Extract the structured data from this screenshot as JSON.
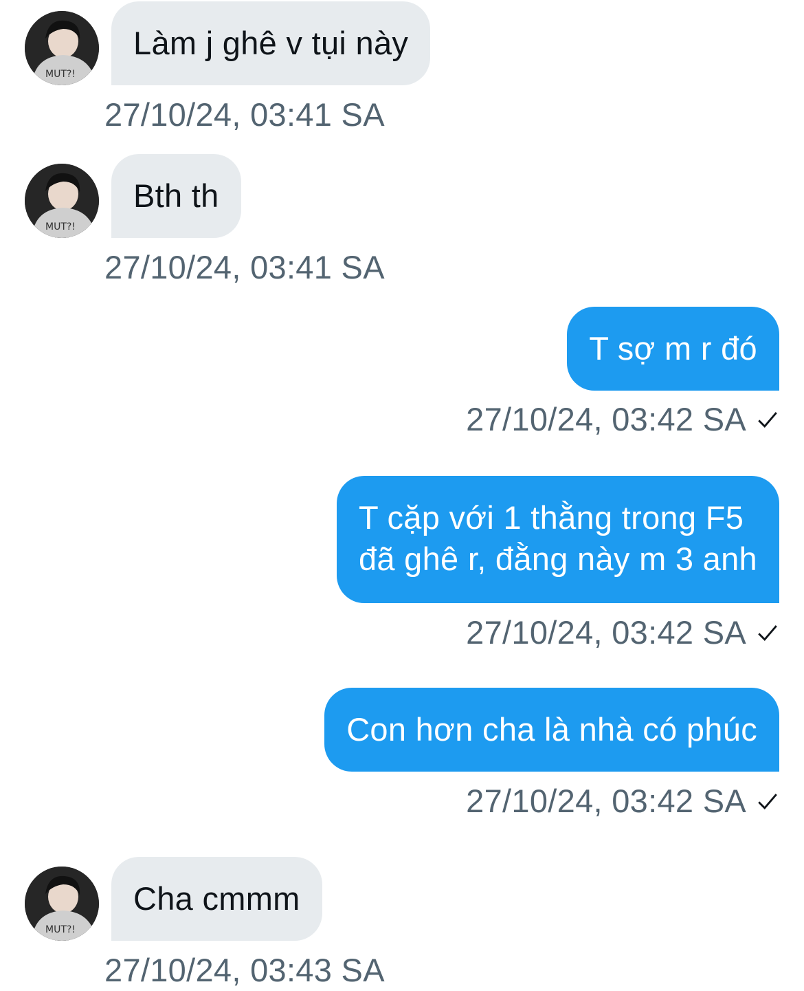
{
  "colors": {
    "incoming_bubble": "#e7ebee",
    "outgoing_bubble": "#1d9bf0",
    "timestamp": "#536471",
    "incoming_text": "#0f1419",
    "outgoing_text": "#ffffff"
  },
  "messages": [
    {
      "direction": "in",
      "text": "Làm j ghê v tụi này",
      "time": "27/10/24, 03:41 SA"
    },
    {
      "direction": "in",
      "text": "Bth th",
      "time": "27/10/24, 03:41 SA"
    },
    {
      "direction": "out",
      "text": "T sợ m r đó",
      "time": "27/10/24, 03:42 SA",
      "status_icon": "check-icon"
    },
    {
      "direction": "out",
      "text_line1": "T cặp với 1 thằng trong F5",
      "text_line2": "đã ghê r, đằng này m 3 anh",
      "time": "27/10/24, 03:42 SA",
      "status_icon": "check-icon"
    },
    {
      "direction": "out",
      "text": "Con hơn cha là nhà có phúc",
      "time": "27/10/24, 03:42 SA",
      "status_icon": "check-icon"
    },
    {
      "direction": "in",
      "text": "Cha cmmm",
      "time": "27/10/24, 03:43 SA"
    }
  ]
}
